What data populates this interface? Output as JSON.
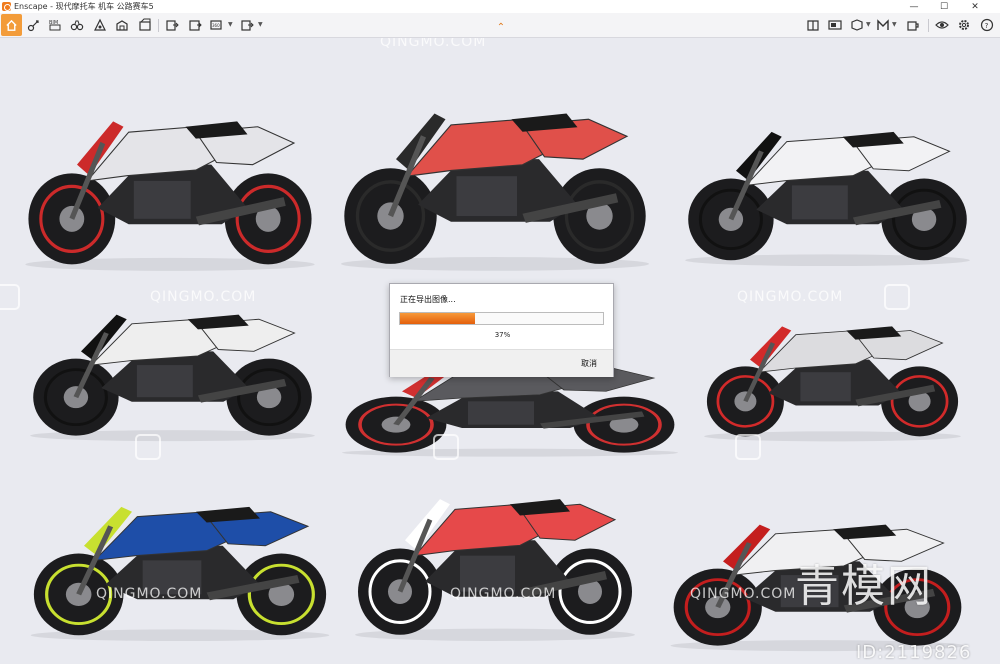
{
  "window": {
    "title": "Enscape - 现代摩托车 机车 公路赛车5",
    "controls": {
      "minimize": "—",
      "maximize": "☐",
      "close": "✕"
    }
  },
  "toolbar": {
    "left_icons": [
      "home-icon",
      "connect-icon",
      "bim-icon",
      "binoculars-icon",
      "capture-icon",
      "asset-library-icon",
      "materials-icon",
      "batch-render-icon",
      "panorama-icon",
      "export-icon",
      "export-video-icon"
    ],
    "right_icons": [
      "views-icon",
      "panorama-gallery-icon",
      "capture-view-icon",
      "model-icon",
      "materials-editor-icon",
      "atmosphere-icon",
      "visibility-icon",
      "settings-icon",
      "help-icon"
    ],
    "home_color": "#f39c3a"
  },
  "viewport": {
    "background": "#e9eaf0",
    "watermark_text": "QINGMO.COM",
    "brand_text": "青模网",
    "id_text": "ID:2119826"
  },
  "bikes": [
    {
      "color": "#e4e4e8",
      "accent": "#cc2a2a"
    },
    {
      "color": "#e0504a",
      "accent": "#2a2a2a"
    },
    {
      "color": "#f2f2f4",
      "accent": "#111111"
    },
    {
      "color": "#eeeeee",
      "accent": "#111111"
    },
    {
      "color": "#5a5a5e",
      "accent": "#d03030"
    },
    {
      "color": "#dcdcdf",
      "accent": "#d22a2a"
    },
    {
      "color": "#1e4ea8",
      "accent": "#c8e030"
    },
    {
      "color": "#e6494a",
      "accent": "#ffffff"
    },
    {
      "color": "#f0f0f2",
      "accent": "#c41e1e"
    }
  ],
  "dialog": {
    "title": "正在导出图像...",
    "progress": 0.37,
    "progress_text": "37%",
    "cancel_label": "取消",
    "progress_color": "#ef7d1e"
  }
}
